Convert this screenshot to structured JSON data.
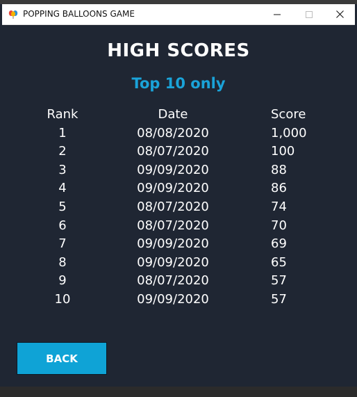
{
  "window": {
    "title": "POPPING BALLOONS GAME",
    "icon": "balloons-icon",
    "controls": [
      "minimize-icon",
      "maximize-icon",
      "close-icon"
    ]
  },
  "main": {
    "heading": "HIGH SCORES",
    "subheading": "Top 10 only",
    "columns": {
      "rank": "Rank",
      "date": "Date",
      "score": "Score"
    },
    "rows": [
      {
        "rank": "1",
        "date": "08/08/2020",
        "score": "1,000"
      },
      {
        "rank": "2",
        "date": "08/07/2020",
        "score": "100"
      },
      {
        "rank": "3",
        "date": "09/09/2020",
        "score": "88"
      },
      {
        "rank": "4",
        "date": "09/09/2020",
        "score": "86"
      },
      {
        "rank": "5",
        "date": "08/07/2020",
        "score": "74"
      },
      {
        "rank": "6",
        "date": "08/07/2020",
        "score": "70"
      },
      {
        "rank": "7",
        "date": "09/09/2020",
        "score": "69"
      },
      {
        "rank": "8",
        "date": "09/09/2020",
        "score": "65"
      },
      {
        "rank": "9",
        "date": "08/07/2020",
        "score": "57"
      },
      {
        "rank": "10",
        "date": "09/09/2020",
        "score": "57"
      }
    ],
    "back_label": "BACK"
  },
  "colors": {
    "background": "#1f2633",
    "accent": "#1aa3d9",
    "button": "#0fa3d6",
    "text": "#ffffff"
  }
}
